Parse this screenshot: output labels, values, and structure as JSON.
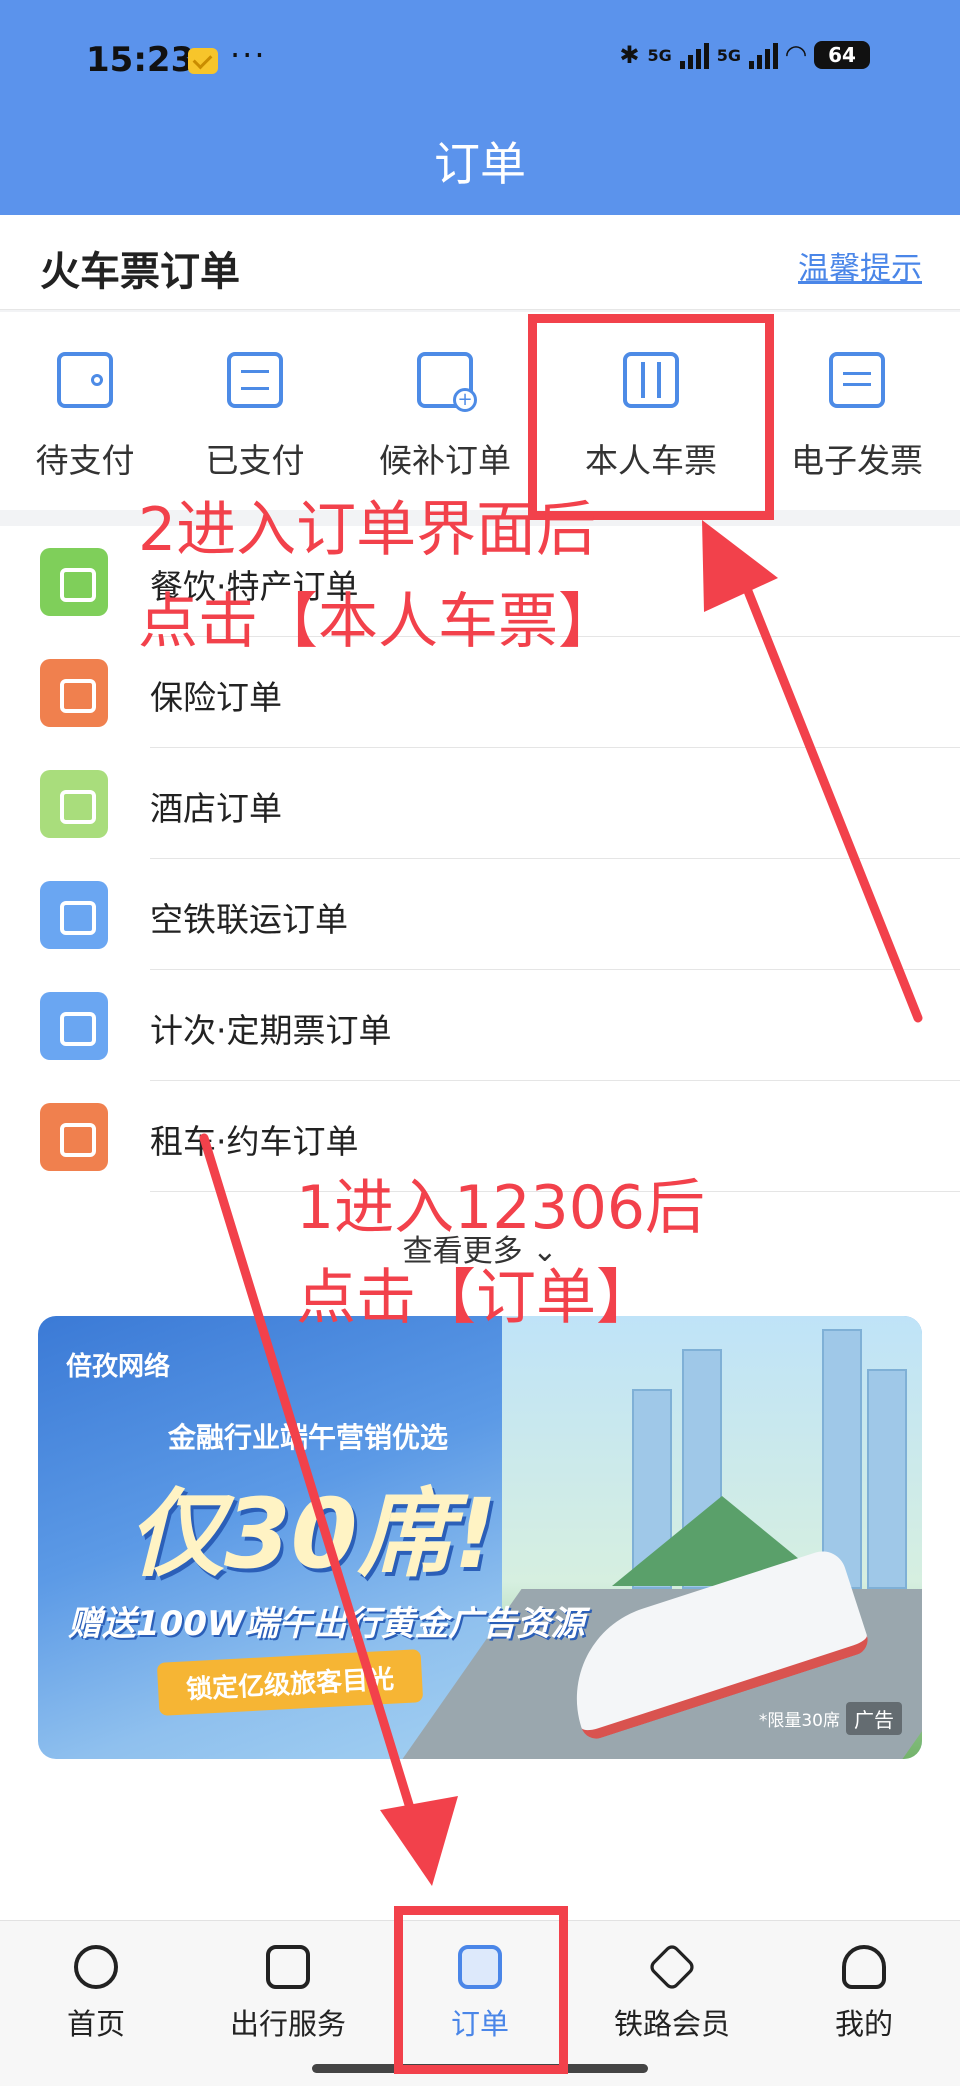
{
  "status_bar": {
    "time": "15:23",
    "dots": "···",
    "network": "5G",
    "battery": "64"
  },
  "header": {
    "title": "订单"
  },
  "train_section": {
    "title": "火车票订单",
    "tip_link": "温馨提示"
  },
  "tabs": [
    {
      "label": "待支付",
      "icon": "wallet-icon"
    },
    {
      "label": "已支付",
      "icon": "clipboard-list-icon"
    },
    {
      "label": "候补订单",
      "icon": "calendar-add-icon"
    },
    {
      "label": "本人车票",
      "icon": "luggage-icon"
    },
    {
      "label": "电子发票",
      "icon": "receipt-icon"
    }
  ],
  "order_list": [
    {
      "label": "餐饮·特产订单",
      "icon": "service-bell-icon",
      "color": "#7fcf5a"
    },
    {
      "label": "保险订单",
      "icon": "shield-icon",
      "color": "#f0804e"
    },
    {
      "label": "酒店订单",
      "icon": "hotel-icon",
      "color": "#a9dd7c"
    },
    {
      "label": "空铁联运订单",
      "icon": "plane-train-icon",
      "color": "#6aa6f2"
    },
    {
      "label": "计次·定期票订单",
      "icon": "ticket-clock-icon",
      "color": "#6aa6f2"
    },
    {
      "label": "租车·约车订单",
      "icon": "car-icon",
      "color": "#f0804e"
    }
  ],
  "more_label": "查看更多",
  "banner": {
    "brand": "倍孜网络",
    "subtitle": "金融行业端午营销优选",
    "headline": "仅30席!",
    "offer": "赠送100W端午出行黄金广告资源",
    "pill": "锁定亿级旅客目光",
    "limit_note": "*限量30席",
    "ad_tag": "广告"
  },
  "bottom_nav": [
    {
      "label": "首页",
      "icon": "home-train-icon",
      "active": false
    },
    {
      "label": "出行服务",
      "icon": "luggage-icon",
      "active": false
    },
    {
      "label": "订单",
      "icon": "order-doc-icon",
      "active": true
    },
    {
      "label": "铁路会员",
      "icon": "diamond-icon",
      "active": false
    },
    {
      "label": "我的",
      "icon": "user-icon",
      "active": false
    }
  ],
  "annotations": {
    "step2_line1": "2进入订单界面后",
    "step2_line2": "点击【本人车票】",
    "step1_line1": "1进入12306后",
    "step1_line2": "点击【订单】",
    "color": "#f2414b"
  }
}
